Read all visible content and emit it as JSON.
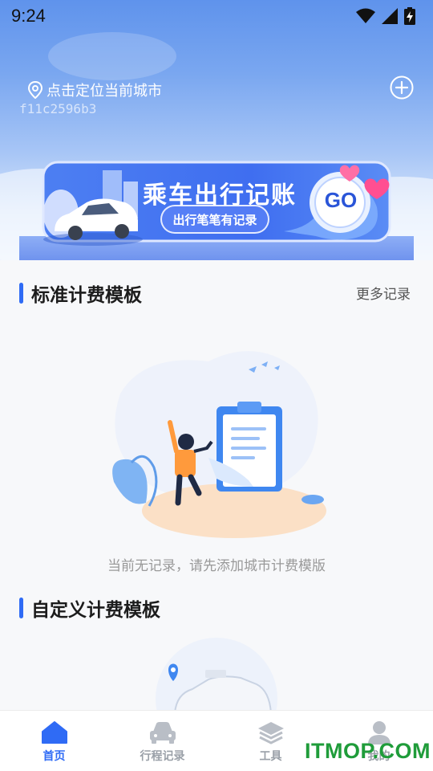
{
  "status_bar": {
    "time": "9:24"
  },
  "header": {
    "location_text": "点击定位当前城市",
    "device_id": "f11c2596b3"
  },
  "banner": {
    "title": "乘车出行记账",
    "subtitle": "出行笔笔有记录",
    "go_label": "GO"
  },
  "standard_section": {
    "title": "标准计费模板",
    "more_label": "更多记录",
    "empty_text": "当前无记录，请先添加城市计费模版"
  },
  "custom_section": {
    "title": "自定义计费模板"
  },
  "tab_bar": {
    "tabs": [
      {
        "label": "首页",
        "icon": "home-icon",
        "active": true
      },
      {
        "label": "行程记录",
        "icon": "car-icon",
        "active": false
      },
      {
        "label": "工具",
        "icon": "layers-icon",
        "active": false
      },
      {
        "label": "我的",
        "icon": "user-icon",
        "active": false
      }
    ]
  },
  "watermark": "ITMOP.COM",
  "colors": {
    "accent": "#2f6bf5",
    "tab_inactive": "#9aa0a8",
    "watermark": "#1f9c3a"
  }
}
